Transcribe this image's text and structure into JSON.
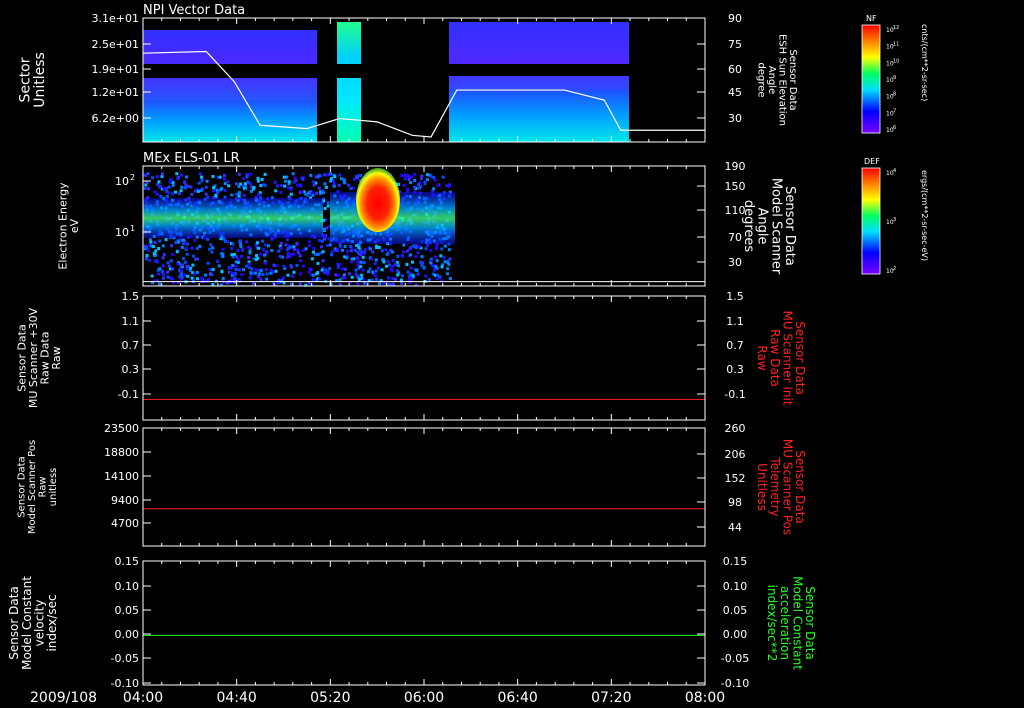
{
  "date_label": "2009/108",
  "time_ticks": [
    "04:00",
    "04:40",
    "05:20",
    "06:00",
    "06:40",
    "07:20",
    "08:00"
  ],
  "colors": {
    "axis": "#ffffff",
    "red": "#ff2020",
    "green": "#20ff20",
    "background": "#000000"
  },
  "panels": [
    {
      "title": "NPI Vector Data",
      "left_label": [
        "Sector",
        "Unitless"
      ],
      "left_ticks": [
        "3.1e+01",
        "2.5e+01",
        "1.9e+01",
        "1.2e+01",
        "6.2e+00"
      ],
      "right_label": [
        "Sensor Data",
        "ESH Sun Elevation",
        "Angle",
        "degree"
      ],
      "right_ticks": [
        "90",
        "75",
        "60",
        "45",
        "30"
      ]
    },
    {
      "title": "MEx ELS-01 LR",
      "left_label": [
        "Electron Energy",
        "eV"
      ],
      "left_ticks": [
        "10",
        "10"
      ],
      "left_tick_exps": [
        "2",
        "1"
      ],
      "right_label": [
        "Sensor Data",
        "Model Scanner",
        "Angle",
        "degrees"
      ],
      "right_ticks": [
        "190",
        "150",
        "110",
        "70",
        "30"
      ]
    },
    {
      "title": "",
      "left_label": [
        "Sensor Data",
        "MU Scanner +30V",
        "Raw Data",
        "Raw"
      ],
      "left_ticks": [
        "1.5",
        "1.1",
        "0.7",
        "0.3",
        "-0.1"
      ],
      "right_label": [
        "Sensor Data",
        "MU Scanner Init",
        "Raw Data",
        "Raw"
      ],
      "right_ticks": [
        "1.5",
        "1.1",
        "0.7",
        "0.3",
        "-0.1"
      ]
    },
    {
      "title": "",
      "left_label": [
        "Sensor Data",
        "Model Scanner Pos",
        "Raw",
        "unitless"
      ],
      "left_ticks": [
        "23500",
        "18800",
        "14100",
        "9400",
        "4700"
      ],
      "right_label": [
        "Sensor Data",
        "MU Scanner Pos",
        "Telemetry",
        "Unitless"
      ],
      "right_ticks": [
        "260",
        "206",
        "152",
        "98",
        "44"
      ]
    },
    {
      "title": "",
      "left_label": [
        "Sensor Data",
        "Model Constant",
        "velocity",
        "index/sec"
      ],
      "left_ticks": [
        "0.15",
        "0.10",
        "0.05",
        "0.00",
        "-0.05",
        "-0.10"
      ],
      "right_label": [
        "Sensor Data",
        "Model Constant",
        "acceleration",
        "index/sec**2"
      ],
      "right_ticks": [
        "0.15",
        "0.10",
        "0.05",
        "0.00",
        "-0.05",
        "-0.10"
      ]
    }
  ],
  "colorbars": [
    {
      "title": "NF",
      "unit": "cnts/(cm**2-sr-sec)",
      "ticks": [
        "10",
        "10",
        "10",
        "10",
        "10",
        "10",
        "10"
      ],
      "tick_exps": [
        "12",
        "11",
        "10",
        "9",
        "8",
        "7",
        "6"
      ]
    },
    {
      "title": "DEF",
      "unit": "ergs/(cm**2-sr-sec-eV)",
      "ticks": [
        "10",
        "10",
        "10"
      ],
      "tick_exps": [
        "4",
        "3",
        "2"
      ]
    }
  ],
  "chart_data": [
    {
      "type": "heatmap",
      "title": "NPI Vector Data",
      "xlabel": "",
      "ylabel": "Sector Unitless",
      "x_range": [
        "04:00",
        "08:00"
      ],
      "y_range": [
        0,
        31
      ],
      "data_intervals": [
        [
          "04:00",
          "05:12"
        ],
        [
          "05:17",
          "05:27"
        ],
        [
          "06:12",
          "07:24"
        ]
      ],
      "overlay_series": {
        "name": "Sensor Data ESH Sun Elevation Angle",
        "x": [
          "04:00",
          "04:27",
          "04:39",
          "04:50",
          "05:10",
          "05:24",
          "05:40",
          "05:55",
          "06:03",
          "06:14",
          "07:00",
          "07:17",
          "07:24",
          "08:00"
        ],
        "y": [
          69,
          70,
          52,
          26,
          24,
          30,
          28,
          20,
          19,
          47,
          47,
          41,
          23,
          23
        ],
        "ylim": [
          16,
          90
        ]
      }
    },
    {
      "type": "heatmap",
      "title": "MEx ELS-01 LR",
      "xlabel": "",
      "ylabel": "Electron Energy eV",
      "y_scale": "log",
      "x_range": [
        "04:00",
        "08:00"
      ],
      "data_interval": [
        "04:00",
        "06:12"
      ],
      "peak_interval": [
        "05:32",
        "05:47"
      ],
      "overlay_series": {
        "name": "Sensor Data Model Scanner Angle",
        "x": [
          "04:00",
          "08:00"
        ],
        "y": [
          7,
          7
        ],
        "ylim": [
          0,
          190
        ]
      }
    },
    {
      "type": "line",
      "series": [
        {
          "name": "Sensor Data MU Scanner Init Raw Data Raw",
          "x": [
            "04:00",
            "08:00"
          ],
          "y": [
            0,
            0
          ]
        }
      ],
      "ylim": [
        -0.3,
        1.5
      ]
    },
    {
      "type": "line",
      "series": [
        {
          "name": "Sensor Data MU Scanner Pos Telemetry Unitless",
          "x": [
            "04:00",
            "08:00"
          ],
          "y": [
            82,
            82
          ]
        }
      ],
      "ylim": [
        0,
        260
      ],
      "left_ylim": [
        0,
        23500
      ]
    },
    {
      "type": "line",
      "series": [
        {
          "name": "Sensor Data Model Constant acceleration index/sec**2",
          "x": [
            "04:00",
            "08:00"
          ],
          "y": [
            0,
            0
          ]
        }
      ],
      "ylim": [
        -0.1,
        0.15
      ]
    }
  ]
}
